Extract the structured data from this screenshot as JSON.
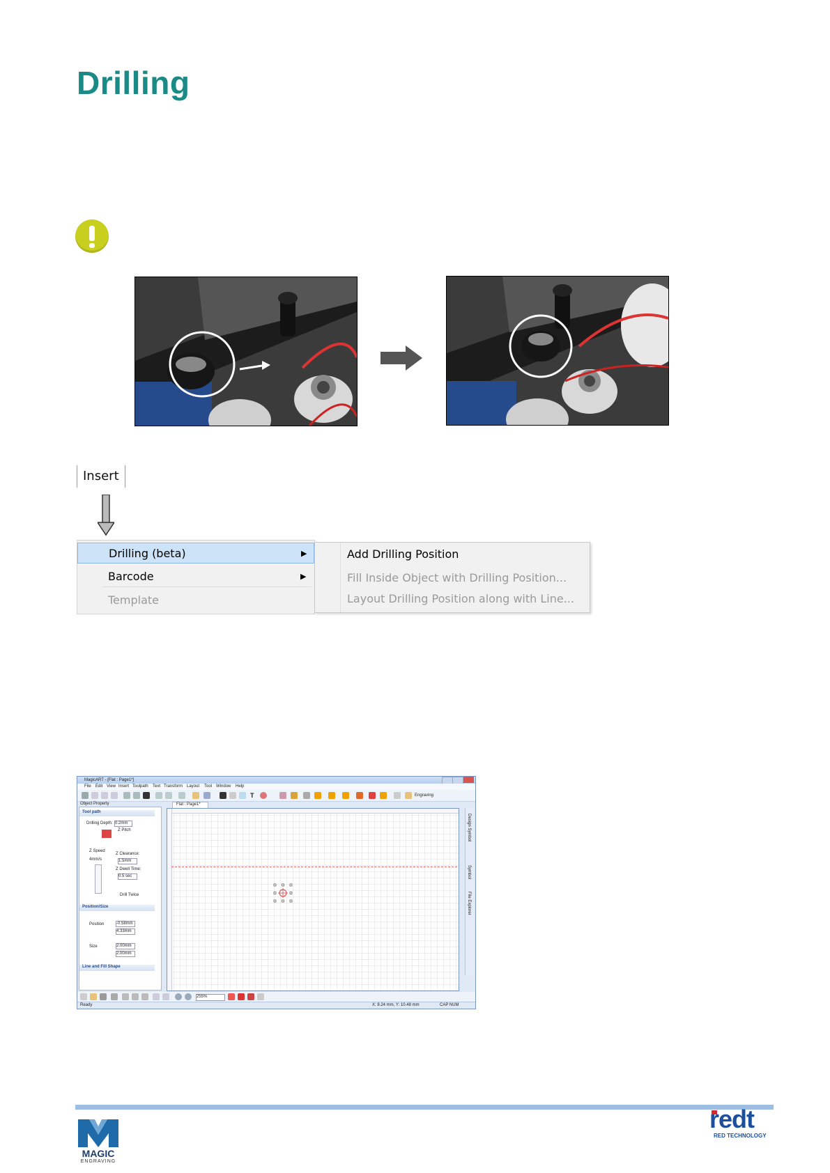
{
  "page": {
    "title": "Drilling"
  },
  "menu": {
    "insert_label": "Insert",
    "items": [
      {
        "label": "Drilling (beta)",
        "enabled": true,
        "highlighted": true
      },
      {
        "label": "Barcode",
        "enabled": true,
        "highlighted": false
      },
      {
        "label": "Template",
        "enabled": false,
        "highlighted": false
      }
    ],
    "submenu": [
      {
        "label": "Add Drilling Position",
        "enabled": true
      },
      {
        "label": "Fill Inside Object with Drilling Position...",
        "enabled": false
      },
      {
        "label": "Layout Drilling Position along with Line...",
        "enabled": false
      }
    ]
  },
  "app": {
    "window_title": "MagicART - [Flat : Page1*]",
    "menubar": [
      "File",
      "Edit",
      "View",
      "Insert",
      "Toolpath",
      "Text",
      "Transform",
      "Layout",
      "Tool",
      "Window",
      "Help"
    ],
    "toolbar_right_label": "Engraving",
    "panel_title": "Object Property",
    "sections": {
      "toolpath": "Tool path",
      "drilling_depth_label": "Drilling Depth:",
      "drilling_depth": "0.2mm",
      "z_pitch": "Z Pitch",
      "z_speed": "Z Speed",
      "z_speed_value": "4mm/s",
      "z_clearance": "Z Clearance:",
      "z_clearance_value": "1.5mm",
      "z_dwell": "Z Dwell Time:",
      "z_dwell_value": "0.5 sec",
      "drill_twice": "Drill Twice",
      "position_size": "Position/Size",
      "position": "Position",
      "pos_x": "-0.58mm",
      "pos_y": "4.33mm",
      "size": "Size",
      "size_x": "2.00mm",
      "size_y": "2.00mm",
      "line_fill": "Line and Fill Shape"
    },
    "tab": "Flat : Page1*",
    "right_tabs": [
      "Design Symbol",
      "Symbol",
      "File Explorer"
    ],
    "zoom": "255%",
    "status_left": "Ready",
    "status_coords": "X: 8.24 mm, Y: 10.48 mm",
    "status_right": "CAP  NUM"
  },
  "footer": {
    "left_logo_text": "MAGIC",
    "left_logo_sub": "ENGRAVING",
    "right_logo_text": "redt",
    "right_logo_sub": "RED TECHNOLOGY"
  },
  "colors": {
    "title": "#1a8a86",
    "warning": "#c9cf1e",
    "footer_rule": "#9dbde3",
    "menu_highlight": "#cde3f7",
    "redt_red": "#d8262b",
    "redt_blue": "#1c4f9c"
  }
}
